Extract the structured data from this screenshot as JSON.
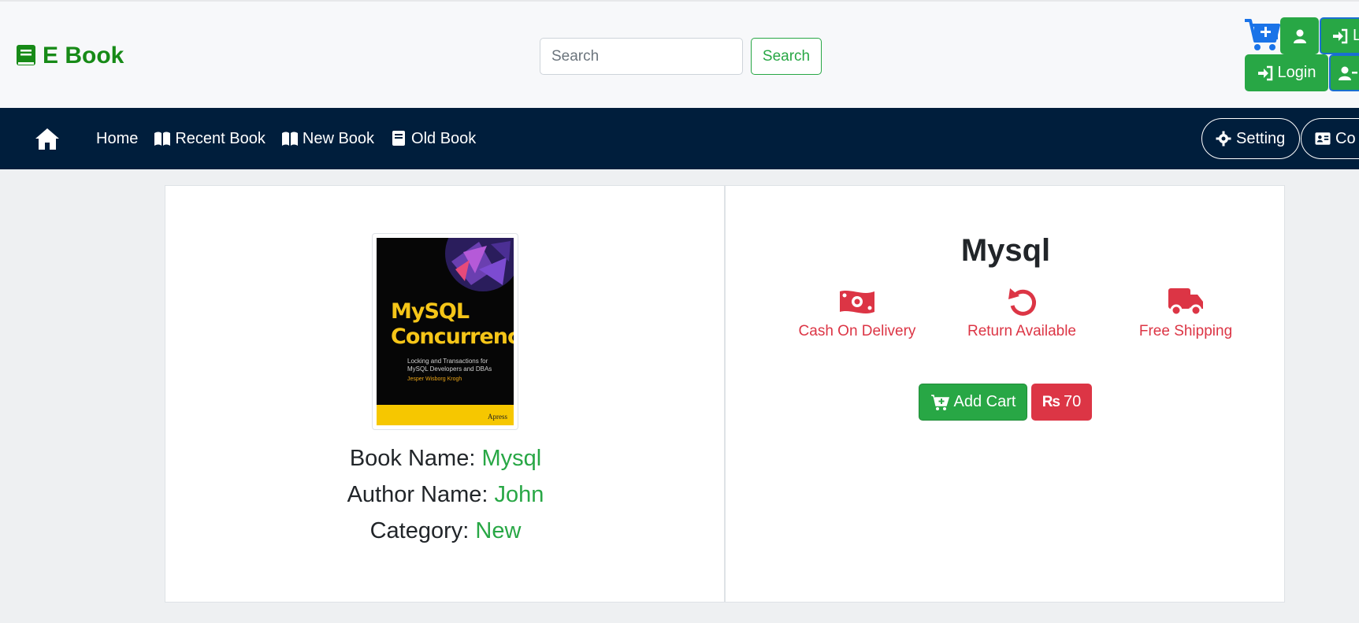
{
  "header": {
    "brand": "E Book",
    "search_placeholder": "Search",
    "search_button": "Search",
    "login_top_label": "L",
    "login_label": "Login"
  },
  "nav": {
    "items": [
      {
        "label": "Home",
        "icon": "none"
      },
      {
        "label": "Recent Book",
        "icon": "book-open-icon"
      },
      {
        "label": "New Book",
        "icon": "book-open-icon"
      },
      {
        "label": "Old Book",
        "icon": "book-icon"
      }
    ],
    "setting": "Setting",
    "contact": "Co"
  },
  "book": {
    "cover": {
      "title_line1": "MySQL",
      "title_line2": "Concurrency",
      "subtitle": "Locking and Transactions for MySQL Developers and DBAs",
      "author": "Jesper Wisborg Krogh",
      "publisher": "Apress"
    },
    "name_label": "Book Name:",
    "name": "Mysql",
    "author_label": "Author Name:",
    "author": "John",
    "category_label": "Category:",
    "category": "New"
  },
  "detail": {
    "title": "Mysql",
    "features": [
      {
        "label": "Cash On Delivery",
        "icon": "money-bill-icon"
      },
      {
        "label": "Return Available",
        "icon": "undo-icon"
      },
      {
        "label": "Free Shipping",
        "icon": "truck-icon"
      }
    ],
    "add_cart": "Add Cart",
    "currency": "₨",
    "price": "70"
  },
  "colors": {
    "brand_green": "#178a17",
    "success": "#28a745",
    "danger": "#dc3545",
    "navbar": "#001e3c",
    "cart_blue": "#1a73e8"
  }
}
